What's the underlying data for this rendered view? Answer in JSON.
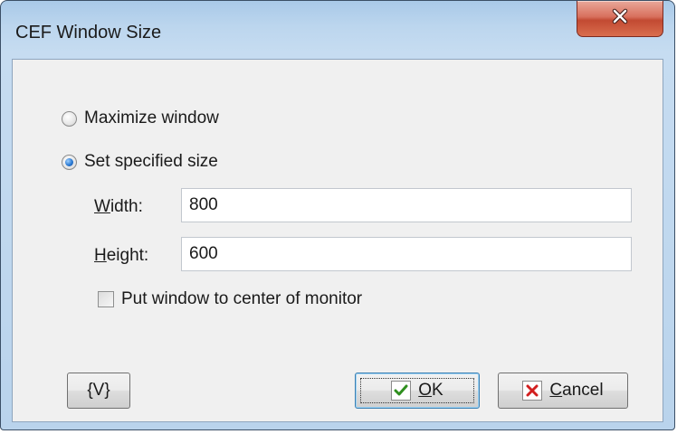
{
  "window": {
    "title": "CEF Window Size"
  },
  "options": {
    "maximize_label": "Maximize window",
    "maximize_selected": false,
    "specified_label": "Set specified size",
    "specified_selected": true
  },
  "fields": {
    "width_label": "Width:",
    "width_value": "800",
    "height_label": "Height:",
    "height_value": "600"
  },
  "center_checkbox": {
    "label": "Put window to center of monitor",
    "checked": false
  },
  "buttons": {
    "variables_label": "{V}",
    "ok_label": "OK",
    "cancel_label": "Cancel"
  },
  "icons": {
    "close": "close-icon",
    "ok": "checkmark-icon",
    "cancel": "x-icon"
  },
  "colors": {
    "close_button": "#c24a32",
    "ok_check": "#2f8f1f",
    "cancel_x": "#d21f1f",
    "radio_selected": "#2b7ad3"
  }
}
